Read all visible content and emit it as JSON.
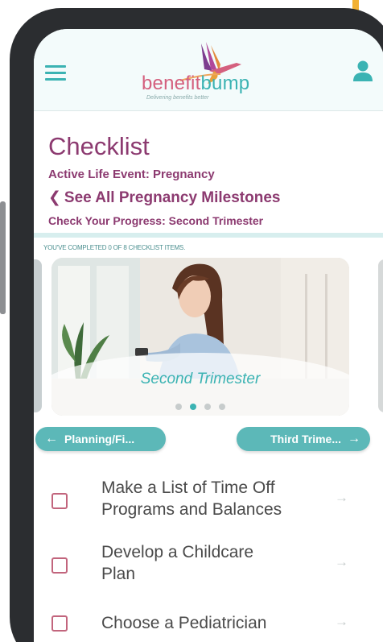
{
  "header": {
    "menu_icon": "hamburger-icon",
    "logo_text_a": "benefit",
    "logo_text_b": "bump",
    "logo_tagline": "Delivering benefits better",
    "user_icon": "user-icon"
  },
  "page": {
    "title": "Checklist",
    "active_event": "Active Life Event: Pregnancy",
    "milestones_link": "See All Pregnancy Milestones",
    "progress_label": "Check Your Progress: Second Trimester",
    "completed_text": "YOU'VE COMPLETED 0 OF 8 CHECKLIST ITEMS.",
    "completed_count": 0,
    "total_items": 8
  },
  "carousel": {
    "caption": "Second Trimester",
    "dot_count": 4,
    "active_dot": 1
  },
  "nav": {
    "prev_label": "Planning/Fi...",
    "next_label": "Third Trime..."
  },
  "checklist": {
    "items": [
      {
        "label_line1": "Make a List of Time Off",
        "label_line2": "Programs and Balances",
        "checked": false
      },
      {
        "label_line1": "Develop a Childcare",
        "label_line2": "Plan",
        "checked": false
      },
      {
        "label_line1": "Choose a Pediatrician",
        "label_line2": "",
        "checked": false
      }
    ]
  },
  "colors": {
    "brand_plum": "#8c3a70",
    "brand_teal": "#3bb3b3",
    "brand_pink": "#d4607e",
    "accent_yellow": "#f2b134"
  }
}
